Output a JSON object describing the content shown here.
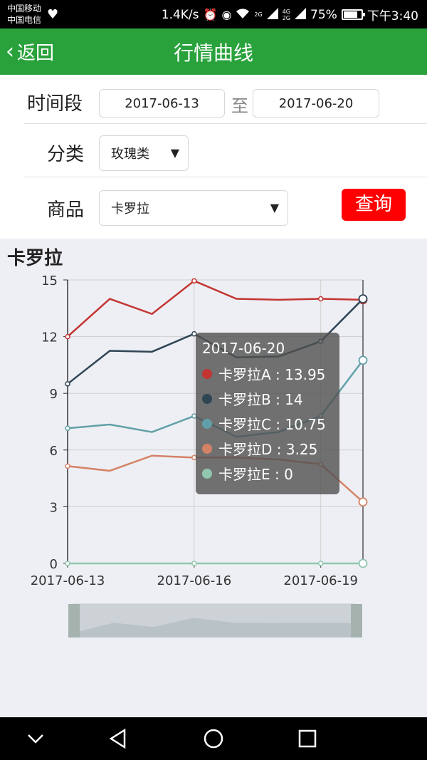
{
  "status_bar": {
    "carrier1": "中国移动",
    "carrier2": "中国电信",
    "net_speed": "1.4K/s",
    "sig_top": "2G",
    "sig_top2": "4G",
    "sig_bottom": "2G",
    "battery": "75%",
    "battery_level": 0.75,
    "time": "下午3:40",
    "icons": [
      "heart-icon",
      "alarm-icon",
      "eye-icon",
      "wifi-icon",
      "signal-icon",
      "battery-icon"
    ]
  },
  "header": {
    "back_label": "返回",
    "title": "行情曲线"
  },
  "form": {
    "period_label": "时间段",
    "start_date": "2017-06-13",
    "to_label": "至",
    "end_date": "2017-06-20",
    "category_label": "分类",
    "category_value": "玫瑰类",
    "product_label": "商品",
    "product_value": "卡罗拉",
    "query_label": "查询",
    "query_color": "#ff0000"
  },
  "chart_data": {
    "type": "line",
    "title": "卡罗拉",
    "x": [
      "2017-06-13",
      "2017-06-14",
      "2017-06-15",
      "2017-06-16",
      "2017-06-17",
      "2017-06-18",
      "2017-06-19",
      "2017-06-20"
    ],
    "x_tick_labels": [
      "2017-06-13",
      "2017-06-16",
      "2017-06-19"
    ],
    "ylim": [
      0,
      15
    ],
    "y_ticks": [
      0,
      3,
      6,
      9,
      12,
      15
    ],
    "grid": true,
    "series": [
      {
        "name": "卡罗拉A",
        "color": "#c23531",
        "values": [
          12.0,
          14.0,
          13.2,
          14.95,
          14.0,
          13.95,
          14.0,
          13.95
        ]
      },
      {
        "name": "卡罗拉B",
        "color": "#2f4554",
        "values": [
          9.5,
          11.25,
          11.2,
          12.15,
          10.9,
          10.95,
          11.75,
          14.0
        ]
      },
      {
        "name": "卡罗拉C",
        "color": "#61a0a8",
        "values": [
          7.15,
          7.35,
          6.95,
          7.8,
          6.7,
          6.95,
          7.8,
          10.75
        ]
      },
      {
        "name": "卡罗拉D",
        "color": "#d48265",
        "values": [
          5.15,
          4.9,
          5.7,
          5.6,
          5.6,
          5.5,
          5.25,
          3.25
        ]
      },
      {
        "name": "卡罗拉E",
        "color": "#91c7ae",
        "values": [
          0,
          0,
          0,
          0,
          0,
          0,
          0,
          0
        ]
      }
    ]
  },
  "tooltip": {
    "date": "2017-06-20",
    "items": [
      {
        "text": "卡罗拉A : 13.95",
        "color": "#c23531"
      },
      {
        "text": "卡罗拉B : 14",
        "color": "#2f4554"
      },
      {
        "text": "卡罗拉C : 10.75",
        "color": "#61a0a8"
      },
      {
        "text": "卡罗拉D : 3.25",
        "color": "#d48265"
      },
      {
        "text": "卡罗拉E : 0",
        "color": "#91c7ae"
      }
    ]
  },
  "nav_bar": {
    "icons": [
      "collapse-icon",
      "back-triangle-icon",
      "home-circle-icon",
      "recents-square-icon"
    ]
  }
}
